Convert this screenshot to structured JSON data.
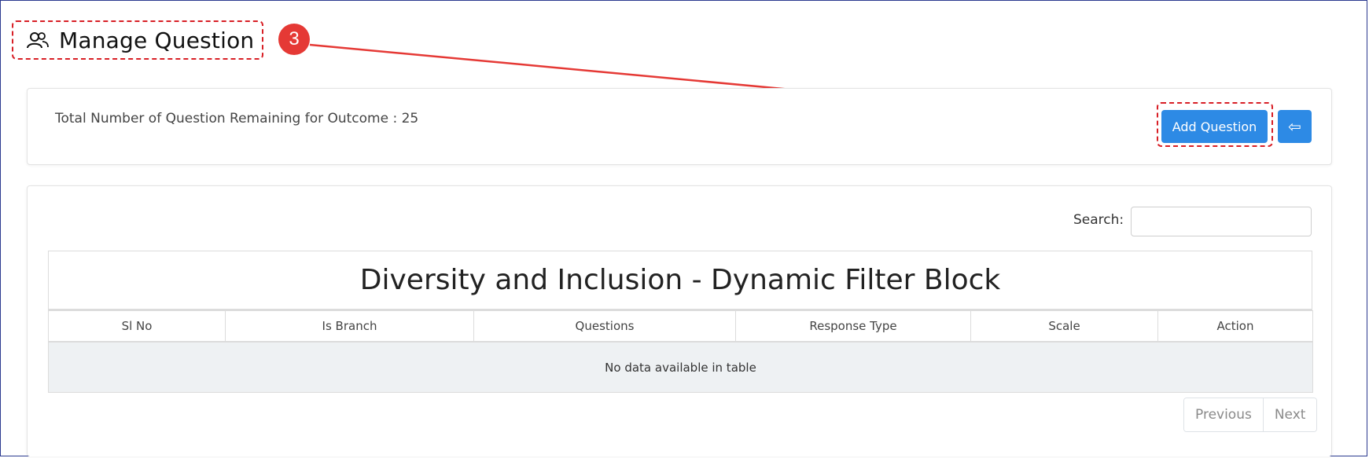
{
  "header": {
    "title": "Manage Question",
    "icon": "users-icon",
    "step_number": "3"
  },
  "summary": {
    "remaining_text": "Total Number of Question Remaining for Outcome : 25"
  },
  "actions": {
    "add_label": "Add Question",
    "back_icon": "return-arrow-icon",
    "back_glyph": "⇦"
  },
  "search": {
    "label": "Search:",
    "value": ""
  },
  "table": {
    "caption": "Diversity and Inclusion - Dynamic Filter Block",
    "columns": [
      "Sl No",
      "Is Branch",
      "Questions",
      "Response Type",
      "Scale",
      "Action"
    ],
    "empty_message": "No data available in table"
  },
  "pagination": {
    "previous": "Previous",
    "next": "Next"
  },
  "colors": {
    "primary": "#2d8ae5",
    "annotation_red": "#d81f26",
    "badge_red": "#e53935",
    "frame": "#2b3a8f"
  }
}
